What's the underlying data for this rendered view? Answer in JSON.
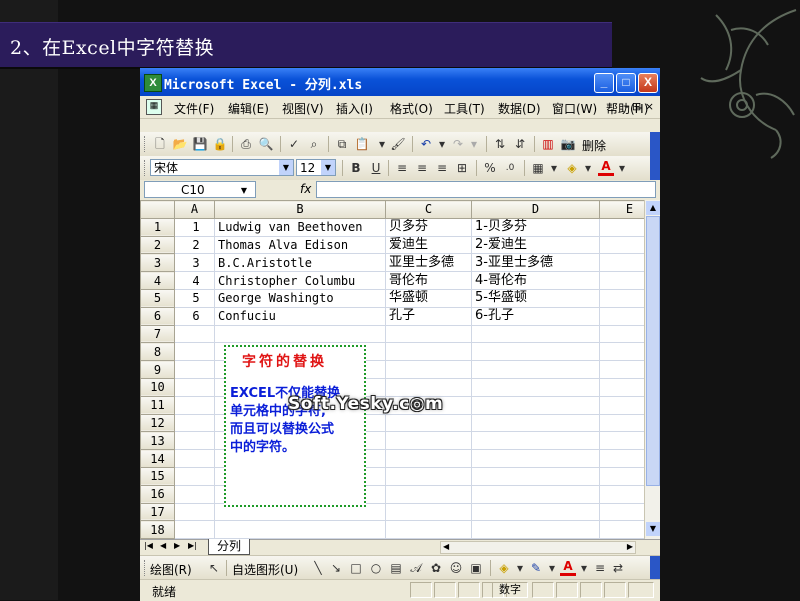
{
  "slide": {
    "title": "2、在Excel中字符替换"
  },
  "window": {
    "title": "Microsoft Excel - 分列.xls",
    "logo": "X",
    "minimize": "_",
    "maximize": "□",
    "close": "X"
  },
  "menu": {
    "items": [
      "文件(F)",
      "编辑(E)",
      "视图(V)",
      "插入(I)",
      "格式(O)",
      "工具(T)",
      "数据(D)",
      "窗口(W)",
      "帮助(H)"
    ],
    "mdi": "- ⊟ ×"
  },
  "toolbar": {
    "delete_label": "删除"
  },
  "format_bar": {
    "font": "宋体",
    "size": "12",
    "bold": "B",
    "underline": "U",
    "percent": "%",
    "fill_icon": "◈",
    "font_color_label": "A"
  },
  "formula_bar": {
    "name_box": "C10",
    "fx": "fx",
    "value": ""
  },
  "grid": {
    "columns": [
      "A",
      "B",
      "C",
      "D",
      "E"
    ],
    "rows": [
      [
        "1",
        "1",
        "Ludwig van Beethoven",
        "贝多芬",
        "1-贝多芬"
      ],
      [
        "2",
        "2",
        "Thomas Alva Edison",
        "爱迪生",
        "2-爱迪生"
      ],
      [
        "3",
        "3",
        "B.C.Aristotle",
        "亚里士多德",
        "3-亚里士多德"
      ],
      [
        "4",
        "4",
        "Christopher Columbu",
        "哥伦布",
        "4-哥伦布"
      ],
      [
        "5",
        "5",
        "George Washingto",
        "华盛顿",
        "5-华盛顿"
      ],
      [
        "6",
        "6",
        "Confuciu",
        "孔子",
        "6-孔子"
      ],
      [
        "7",
        "",
        "",
        "",
        ""
      ],
      [
        "8",
        "",
        "",
        "",
        ""
      ],
      [
        "9",
        "",
        "",
        "",
        ""
      ],
      [
        "10",
        "",
        "",
        "",
        ""
      ],
      [
        "11",
        "",
        "",
        "",
        ""
      ],
      [
        "12",
        "",
        "",
        "",
        ""
      ],
      [
        "13",
        "",
        "",
        "",
        ""
      ],
      [
        "14",
        "",
        "",
        "",
        ""
      ],
      [
        "15",
        "",
        "",
        "",
        ""
      ],
      [
        "16",
        "",
        "",
        "",
        ""
      ],
      [
        "17",
        "",
        "",
        "",
        ""
      ],
      [
        "18",
        "",
        "",
        "",
        ""
      ]
    ]
  },
  "callout": {
    "title": "字符的替换",
    "body": [
      "EXCEL不仅能替换",
      "单元格中的字符,",
      "而且可以替换公式",
      "中的字符。"
    ]
  },
  "watermark": "Soft.Yesky.c◎m",
  "sheet_tab": {
    "name": "分列"
  },
  "drawing": {
    "draw_label": "绘图(R)",
    "autoshapes_label": "自选图形(U)"
  },
  "status": {
    "ready": "就绪",
    "num": "数字"
  }
}
